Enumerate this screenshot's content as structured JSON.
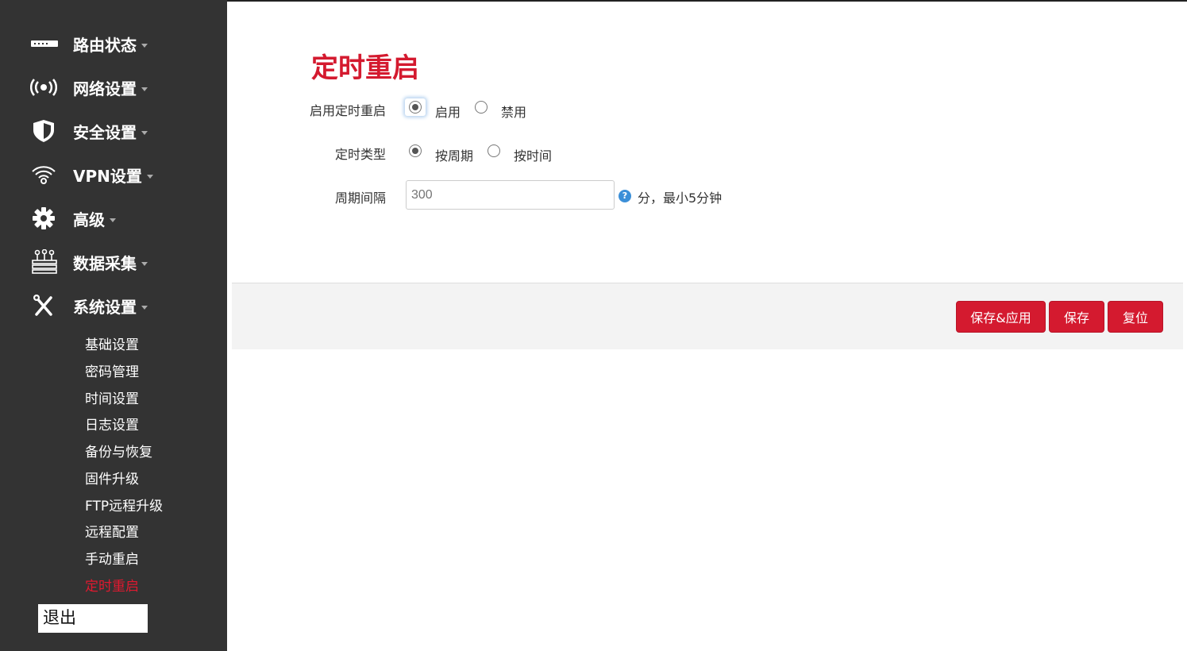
{
  "sidebar": {
    "menu": [
      {
        "label": "路由状态",
        "icon": "router-icon"
      },
      {
        "label": "网络设置",
        "icon": "wireless-signal-icon"
      },
      {
        "label": "安全设置",
        "icon": "shield-icon"
      },
      {
        "label": "VPN设置",
        "icon": "wifi-icon"
      },
      {
        "label": "高级",
        "icon": "gear-icon"
      },
      {
        "label": "数据采集",
        "icon": "data-collection-icon"
      },
      {
        "label": "系统设置",
        "icon": "tools-icon"
      }
    ],
    "submenu": [
      {
        "label": "基础设置"
      },
      {
        "label": "密码管理"
      },
      {
        "label": "时间设置"
      },
      {
        "label": "日志设置"
      },
      {
        "label": "备份与恢复"
      },
      {
        "label": "固件升级"
      },
      {
        "label": "FTP远程升级"
      },
      {
        "label": "远程配置"
      },
      {
        "label": "手动重启"
      },
      {
        "label": "定时重启",
        "active": true
      }
    ],
    "logout_label": "退出"
  },
  "page": {
    "title": "定时重启",
    "enable": {
      "label": "启用定时重启",
      "options": [
        "启用",
        "禁用"
      ],
      "selected": "启用"
    },
    "type": {
      "label": "定时类型",
      "options": [
        "按周期",
        "按时间"
      ],
      "selected": "按周期"
    },
    "interval": {
      "label": "周期间隔",
      "placeholder": "300",
      "hint": "分，最小5分钟"
    }
  },
  "actions": {
    "save_apply": "保存&应用",
    "save": "保存",
    "reset": "复位"
  },
  "colors": {
    "accent": "#d41a2f",
    "sidebar_bg": "#333333",
    "action_bar_bg": "#f3f3f3"
  }
}
